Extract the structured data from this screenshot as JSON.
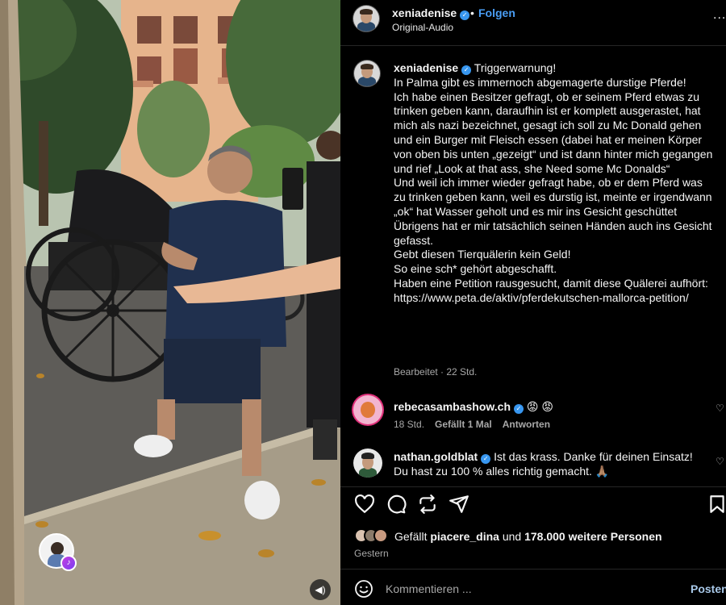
{
  "post": {
    "username": "xeniadenise",
    "separator": "•",
    "follow_label": "Folgen",
    "audio_label": "Original-Audio",
    "more_label": "..."
  },
  "caption": {
    "username": "xeniadenise",
    "lines": [
      "Triggerwarnung!",
      "",
      "In Palma gibt es immernoch abgemagerte durstige Pferde!",
      "Ich habe einen Besitzer gefragt, ob er seinem Pferd etwas zu trinken geben kann, darauf­hin ist er komplett ausgerastet, hat mich als nazi bezeichnet, gesagt ich soll zu Mc Donald gehen und ein Burger mit Fleisch essen (dabei hat er meinen Körper von oben bis unten „gezeigt“ und ist dann hinter mich gegangen und rief „Look at that ass, she Need some Mc Donalds“",
      "Und weil ich immer wieder gefragt habe, ob er dem Pferd was zu trinken geben kann, weil es durstig ist, meinte er irgendwann „ok“ hat Wasser geholt und es mir ins Gesicht geschüttet",
      "Übrigens hat er mir tatsächlich seinen Händen auch ins Gesicht gefasst.",
      "",
      "Gebt diesen Tierquälerin kein Geld!",
      "So eine sch* gehört abgeschafft.",
      "",
      "Haben eine Petition rausgesucht, damit diese Quälerei aufhört:",
      "",
      "https://www.peta.de/aktiv/pferdekutschen-mallorca-petition/"
    ],
    "edited_label": "Bearbeitet · 22 Std."
  },
  "comments": [
    {
      "username": "rebecasambashow.ch",
      "text": "😡 😡",
      "time": "18 Std.",
      "liked_label": "Gefällt 1 Mal",
      "reply_label": "Antworten"
    },
    {
      "username": "nathan.goldblat",
      "text": "Ist das krass. Danke für deinen Einsatz! Du hast zu 100 % alles richtig gemacht. 🙏🏽",
      "time": "",
      "liked_label": "",
      "reply_label": ""
    }
  ],
  "likes": {
    "prefix": "Gefällt ",
    "user": "piacere_dina",
    "middle": " und ",
    "count": "178.000 weitere Personen"
  },
  "date_label": "Gestern",
  "composer": {
    "placeholder": "Kommentieren ...",
    "post_label": "Posten"
  },
  "icons": [
    "verified-icon",
    "heart-icon",
    "comment-icon",
    "repost-icon",
    "share-icon",
    "bookmark-icon",
    "emoji-icon",
    "mute-icon",
    "more-icon"
  ],
  "colors": {
    "background": "#000000",
    "text": "#f5f5f5",
    "muted": "#a8a8a8",
    "link_blue": "#4a9ef5",
    "verified": "#3897f0"
  }
}
